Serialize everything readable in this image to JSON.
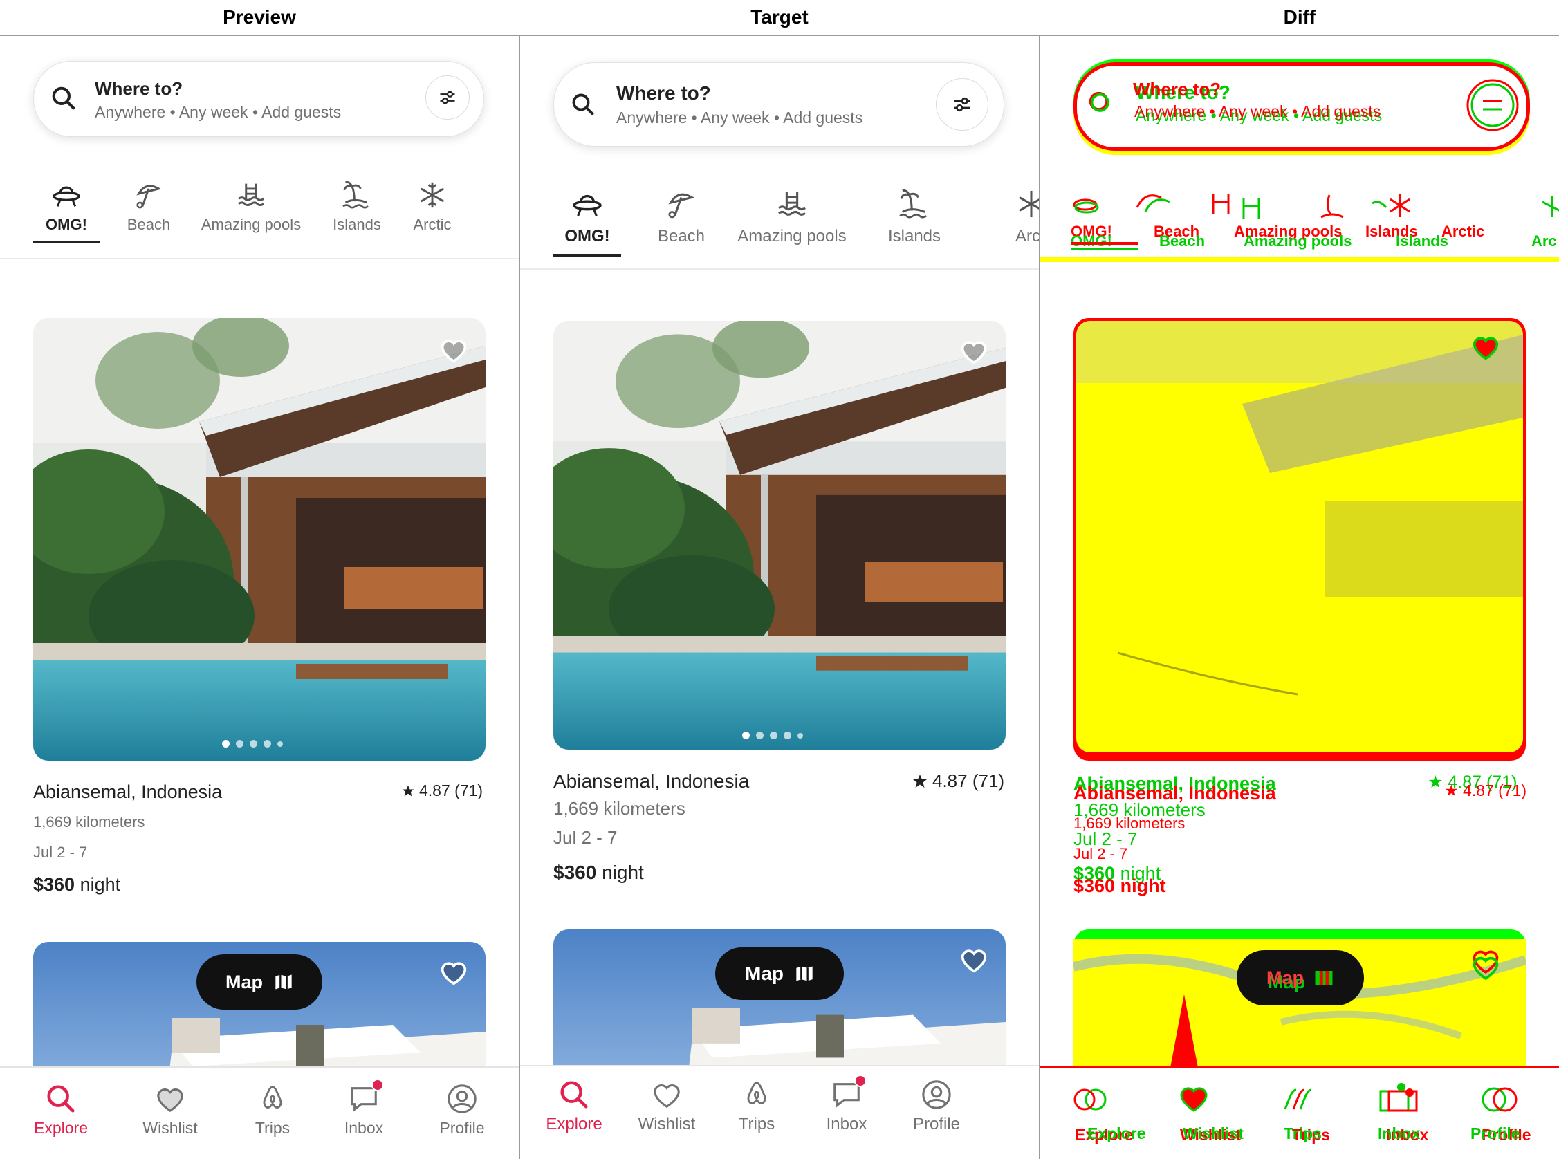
{
  "headers": {
    "preview": "Preview",
    "target": "Target",
    "diff": "Diff"
  },
  "search": {
    "title": "Where to?",
    "subtitle": "Anywhere • Any week • Add guests"
  },
  "categories": [
    {
      "label": "OMG!",
      "icon": "ufo-icon",
      "active": true
    },
    {
      "label": "Beach",
      "icon": "umbrella-icon",
      "active": false
    },
    {
      "label": "Amazing pools",
      "icon": "pool-icon",
      "active": false
    },
    {
      "label": "Islands",
      "icon": "island-icon",
      "active": false
    },
    {
      "label": "Arctic",
      "icon": "snowflake-icon",
      "active": false
    }
  ],
  "target_category_overflow": "Arc",
  "listing": {
    "location": "Abiansemal, Indonesia",
    "rating": "4.87 (71)",
    "distance": "1,669 kilometers",
    "dates": "Jul 2 - 7",
    "price": "$360",
    "price_unit": "night",
    "photo_count": 5
  },
  "map_button": {
    "label": "Map"
  },
  "nav": [
    {
      "label": "Explore",
      "icon": "search-icon",
      "active": true
    },
    {
      "label": "Wishlist",
      "icon": "heart-icon",
      "active": false
    },
    {
      "label": "Trips",
      "icon": "airbnb-icon",
      "active": false
    },
    {
      "label": "Inbox",
      "icon": "message-icon",
      "active": false,
      "badge": true
    },
    {
      "label": "Profile",
      "icon": "profile-icon",
      "active": false
    }
  ],
  "colors": {
    "accent": "#e0224e",
    "text": "#222222",
    "muted": "#717171",
    "diff_yellow": "#ffff00",
    "diff_red": "#ff0000",
    "diff_green": "#00ff00"
  }
}
